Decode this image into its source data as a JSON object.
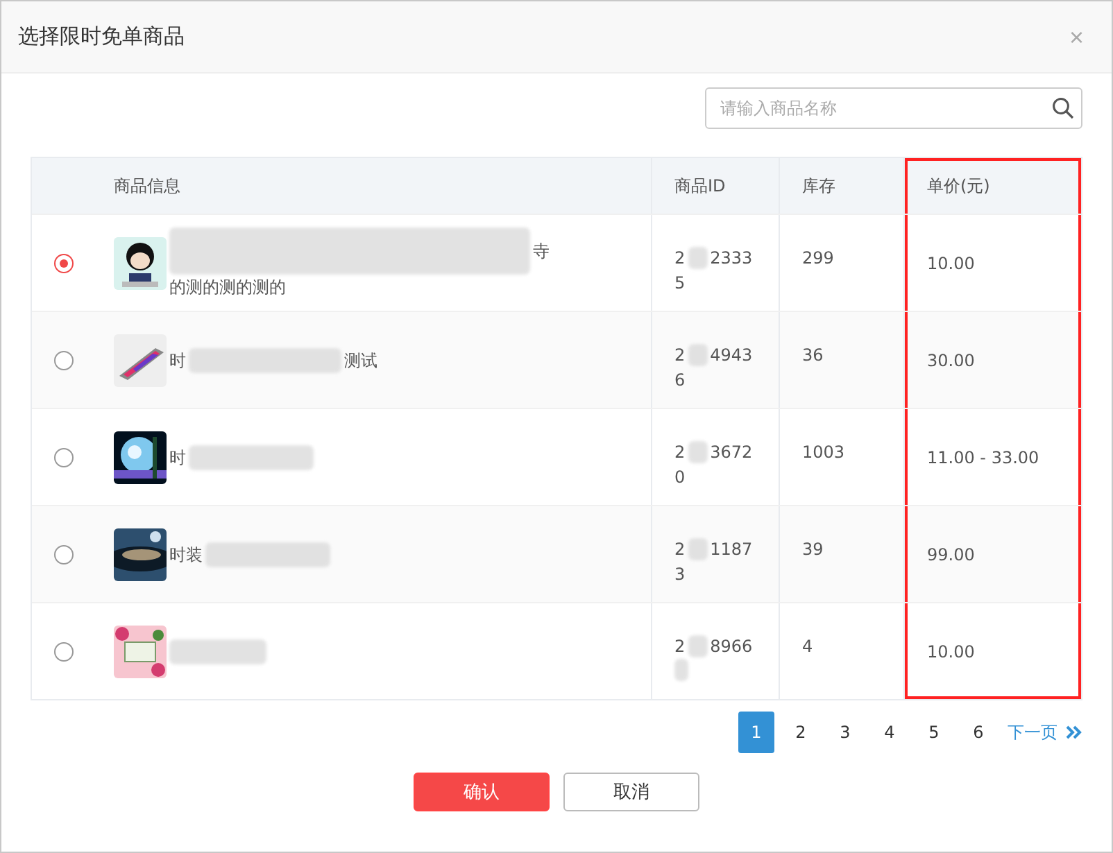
{
  "dialog": {
    "title": "选择限时免单商品",
    "close": "×"
  },
  "search": {
    "placeholder": "请输入商品名称"
  },
  "table": {
    "columns": [
      {
        "label": "商品信息",
        "highlighted": false
      },
      {
        "label": "商品ID",
        "highlighted": false
      },
      {
        "label": "库存",
        "highlighted": false
      },
      {
        "label": "单价(元)",
        "highlighted": true
      }
    ],
    "rows": [
      {
        "selected": true,
        "name_start": "",
        "name_end": "寺",
        "name_line2": "的测的测的测的",
        "id_start": "2",
        "id_end": "2333",
        "id_line2": "5",
        "stock": "299",
        "price": "10.00"
      },
      {
        "selected": false,
        "name_start": "时",
        "name_end": "测试",
        "name_line2": "",
        "id_start": "2",
        "id_end": "4943",
        "id_line2": "6",
        "stock": "36",
        "price": "30.00"
      },
      {
        "selected": false,
        "name_start": "时",
        "name_end": "",
        "name_line2": "",
        "id_start": "2",
        "id_end": "3672",
        "id_line2": "0",
        "stock": "1003",
        "price": "11.00 - 33.00"
      },
      {
        "selected": false,
        "name_start": "时装",
        "name_end": "",
        "name_line2": "",
        "id_start": "2",
        "id_end": "1187",
        "id_line2": "3",
        "stock": "39",
        "price": "99.00"
      },
      {
        "selected": false,
        "name_start": "",
        "name_end": "",
        "name_line2": "",
        "id_start": "2",
        "id_end": "8966",
        "id_line2": "",
        "stock": "4",
        "price": "10.00"
      }
    ]
  },
  "pagination": {
    "pages": [
      {
        "label": "1",
        "selected": true
      },
      {
        "label": "2",
        "selected": false
      },
      {
        "label": "3",
        "selected": false
      },
      {
        "label": "4",
        "selected": false
      },
      {
        "label": "5",
        "selected": false
      },
      {
        "label": "6",
        "selected": false
      }
    ],
    "next": "下一页"
  },
  "buttons": [
    {
      "label": "确认",
      "kind": "primary"
    },
    {
      "label": "取消",
      "kind": "secondary"
    }
  ]
}
